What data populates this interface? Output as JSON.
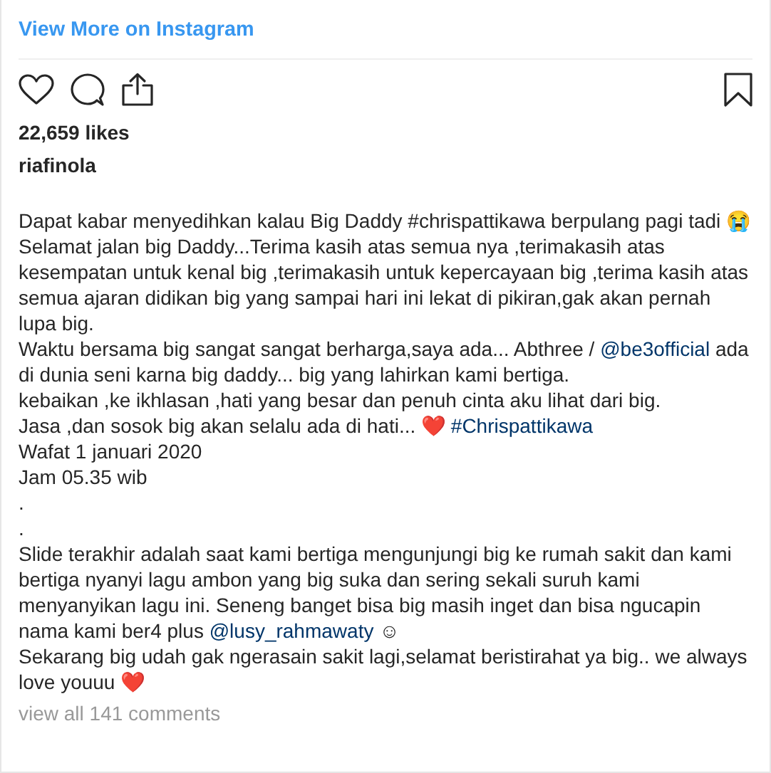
{
  "header": {
    "link": "View More on Instagram"
  },
  "actions": {
    "liked": false,
    "saved": false
  },
  "likes": "22,659 likes",
  "username": "riafinola",
  "caption": [
    [
      {
        "kind": "text",
        "text": "Dapat kabar menyedihkan kalau Big Daddy #chrispattikawa berpulang pagi tadi 😭"
      }
    ],
    [
      {
        "kind": "text",
        "text": "Selamat jalan big Daddy...Terima kasih atas semua nya ,terimakasih atas kesempatan untuk kenal big ,terimakasih untuk kepercayaan big ,terima kasih atas semua ajaran didikan big yang sampai hari ini lekat di pikiran,gak akan pernah lupa big."
      }
    ],
    [
      {
        "kind": "text",
        "text": "Waktu bersama big sangat sangat berharga,saya ada... Abthree / "
      },
      {
        "kind": "link",
        "text": "@be3official"
      },
      {
        "kind": "text",
        "text": " ada di dunia seni karna big daddy... big yang lahirkan kami bertiga."
      }
    ],
    [
      {
        "kind": "text",
        "text": "kebaikan ,ke ikhlasan ,hati yang besar dan penuh cinta aku lihat dari big."
      }
    ],
    [
      {
        "kind": "text",
        "text": "Jasa ,dan sosok big akan selalu ada di hati... ❤️ "
      },
      {
        "kind": "link",
        "text": "#Chrispattikawa"
      }
    ],
    [
      {
        "kind": "text",
        "text": "Wafat 1 januari 2020"
      }
    ],
    [
      {
        "kind": "text",
        "text": "Jam 05.35 wib"
      }
    ],
    [
      {
        "kind": "text",
        "text": "."
      }
    ],
    [
      {
        "kind": "text",
        "text": "."
      }
    ],
    [
      {
        "kind": "text",
        "text": "Slide terakhir adalah saat kami bertiga mengunjungi big ke rumah sakit dan kami bertiga nyanyi lagu ambon yang big suka dan sering sekali suruh kami menyanyikan lagu ini. Seneng banget bisa big masih inget dan bisa ngucapin nama kami ber4 plus "
      },
      {
        "kind": "link",
        "text": "@lusy_rahmawaty"
      },
      {
        "kind": "text",
        "text": " ☺"
      }
    ],
    [
      {
        "kind": "text",
        "text": "Sekarang big udah gak ngerasain sakit lagi,selamat beristirahat ya big.. we always love youuu ❤️"
      }
    ]
  ],
  "comments_link": "view all 141 comments"
}
